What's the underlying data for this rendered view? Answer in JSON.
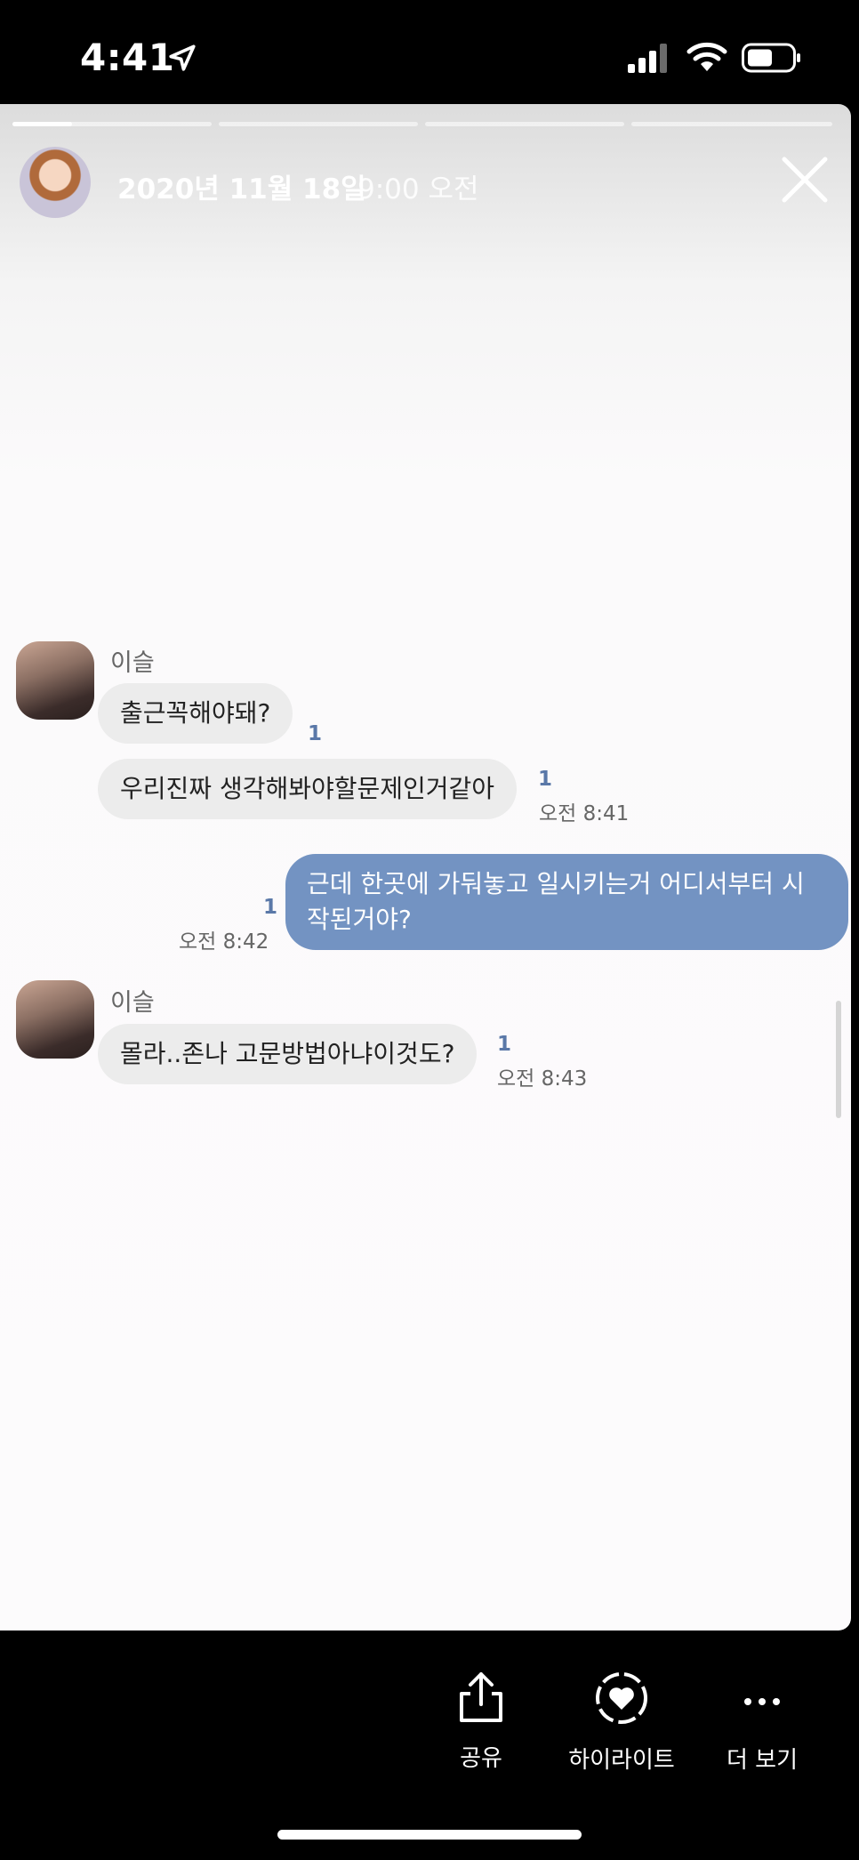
{
  "status_bar": {
    "time": "4:41"
  },
  "story": {
    "date": "2020년 11월 18일",
    "time": "9:00 오전",
    "segments": 4,
    "progress_first_segment": 0.3
  },
  "chat": {
    "messages": [
      {
        "sender": "이슬",
        "text": "출근꼭해야돼?",
        "unread": "1"
      },
      {
        "text": "우리진짜 생각해봐야할문제인거같아",
        "unread": "1",
        "time": "오전 8:41"
      },
      {
        "mine": true,
        "text": "근데 한곳에 가둬놓고 일시키는거 어디서부터 시작된거야?",
        "unread": "1",
        "time": "오전 8:42"
      },
      {
        "sender": "이슬",
        "text": "몰라..존나 고문방법아냐이것도?",
        "unread": "1",
        "time": "오전 8:43"
      }
    ]
  },
  "actions": {
    "share": "공유",
    "highlight": "하이라이트",
    "more": "더 보기"
  }
}
